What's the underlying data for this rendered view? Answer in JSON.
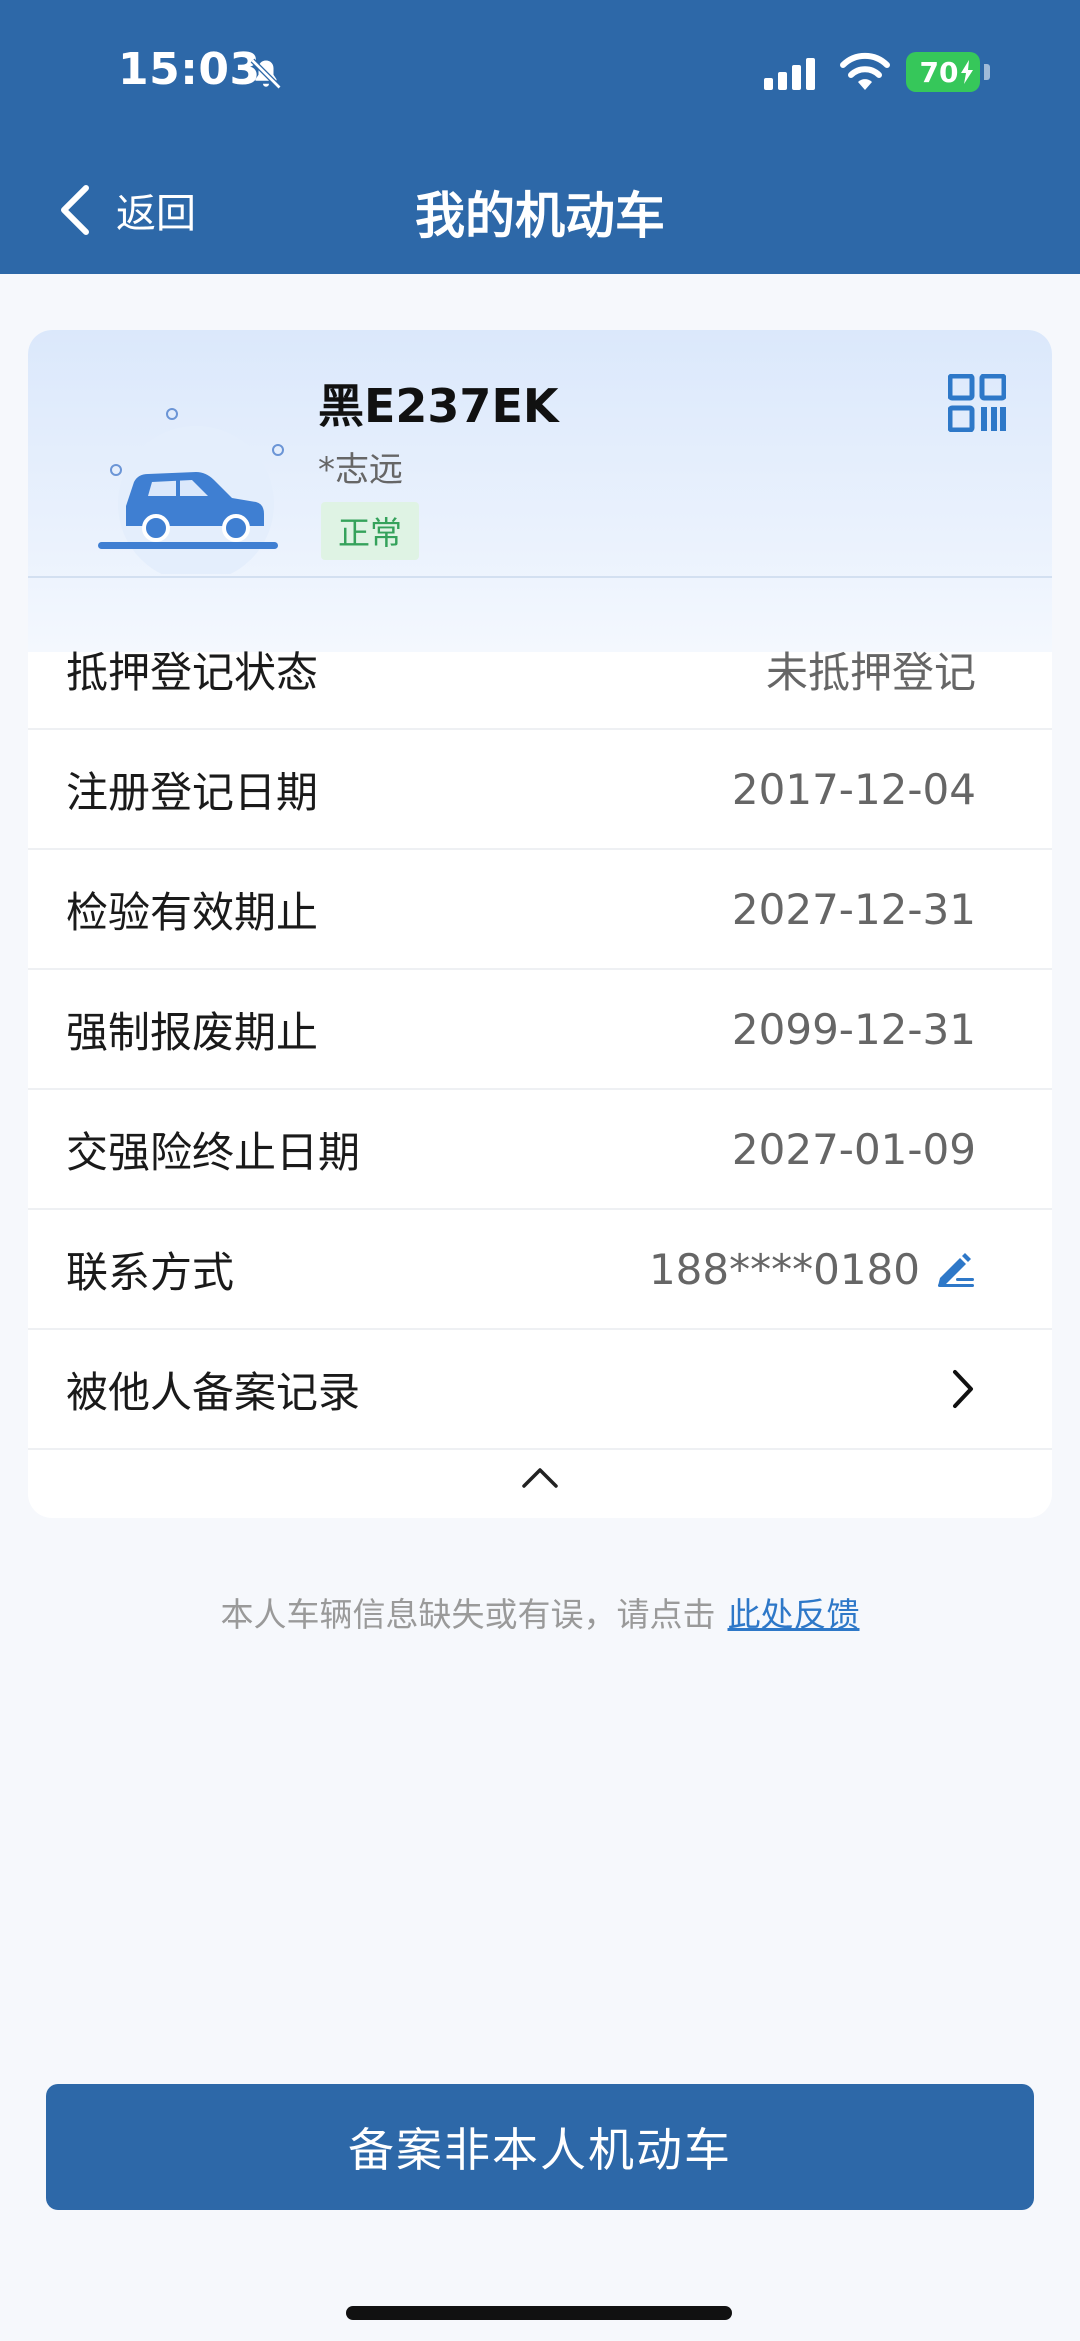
{
  "status_bar": {
    "time": "15:03",
    "battery": "70",
    "icons": [
      "bell-slash-icon",
      "signal-icon",
      "wifi-icon",
      "battery-icon"
    ]
  },
  "nav": {
    "back_label": "返回",
    "title": "我的机动车"
  },
  "vehicle": {
    "plate": "黑E237EK",
    "owner": "*志远",
    "status": "正常"
  },
  "details": [
    {
      "label": "抵押登记状态",
      "value": "未抵押登记"
    },
    {
      "label": "注册登记日期",
      "value": "2017-12-04"
    },
    {
      "label": "检验有效期止",
      "value": "2027-12-31"
    },
    {
      "label": "强制报废期止",
      "value": "2099-12-31"
    },
    {
      "label": "交强险终止日期",
      "value": "2027-01-09"
    },
    {
      "label": "联系方式",
      "value": "188****0180"
    },
    {
      "label": "被他人备案记录",
      "value": ""
    }
  ],
  "feedback": {
    "text": "本人车辆信息缺失或有误，请点击",
    "link": "此处反馈"
  },
  "primary_button": "备案非本人机动车",
  "colors": {
    "primary": "#2d68a8",
    "accent_blue": "#2e78c8",
    "status_green": "#35a25b",
    "status_green_bg": "#dff3e4"
  }
}
